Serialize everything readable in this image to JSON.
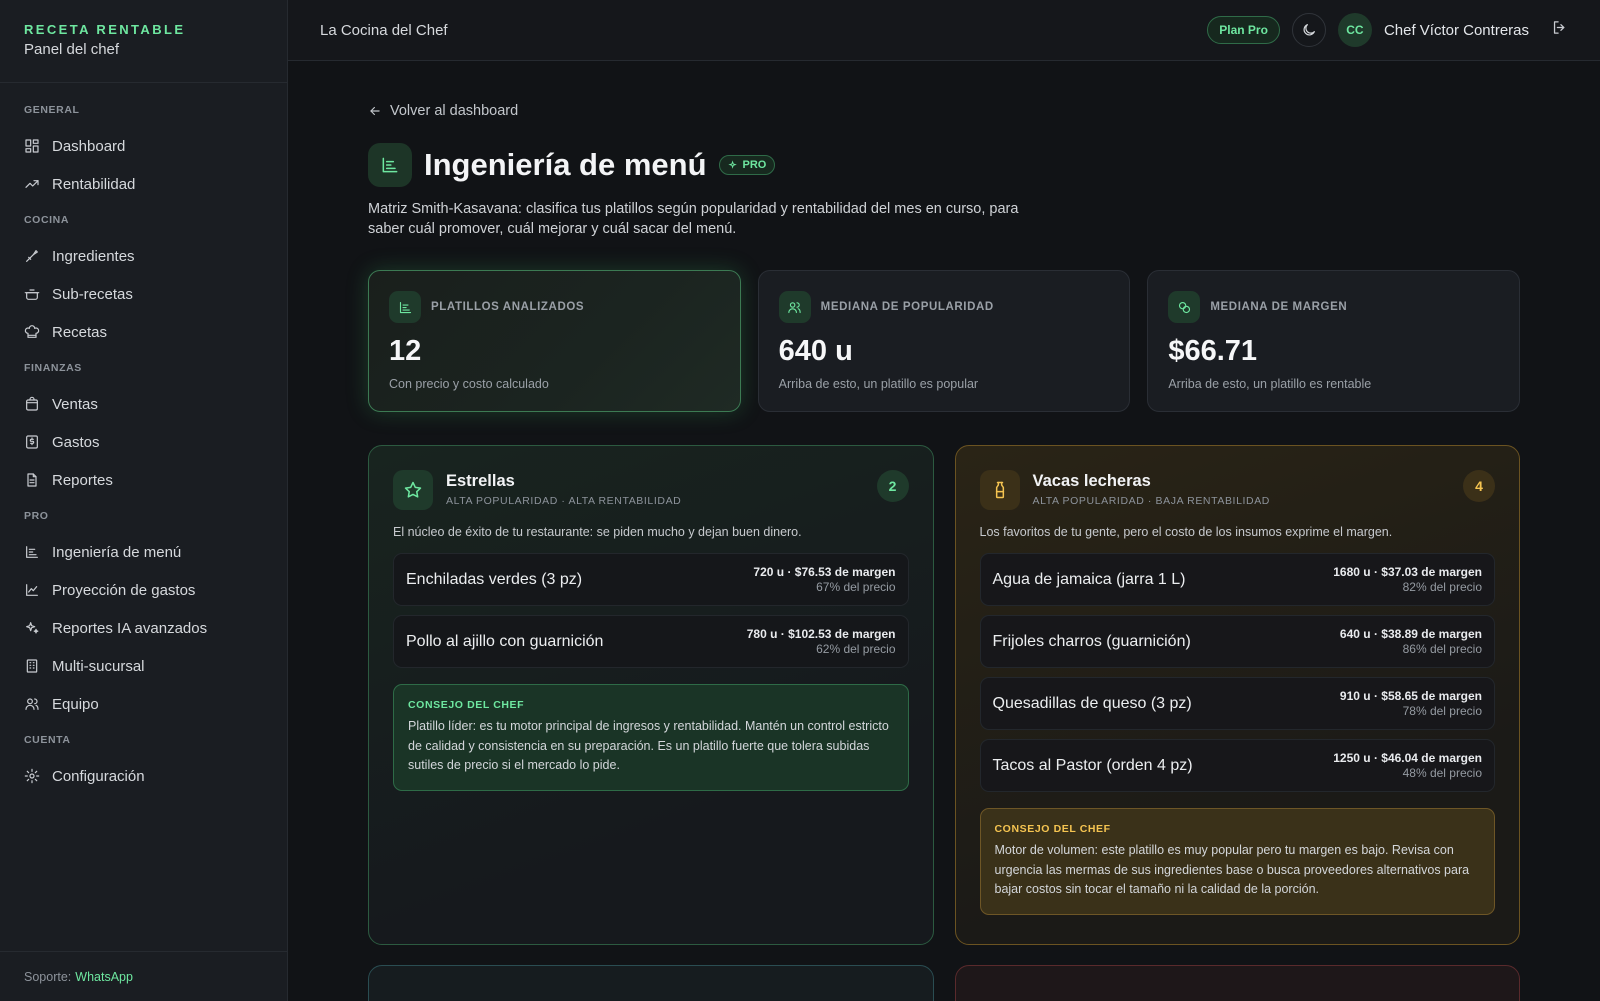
{
  "brand": {
    "name": "RECETA RENTABLE",
    "sub": "Panel del chef"
  },
  "sidebar": {
    "sections": [
      {
        "title": "GENERAL",
        "items": [
          {
            "label": "Dashboard",
            "icon": "grid-icon"
          },
          {
            "label": "Rentabilidad",
            "icon": "trending-up-icon"
          }
        ]
      },
      {
        "title": "COCINA",
        "items": [
          {
            "label": "Ingredientes",
            "icon": "knife-icon"
          },
          {
            "label": "Sub-recetas",
            "icon": "pot-icon"
          },
          {
            "label": "Recetas",
            "icon": "chef-hat-icon"
          }
        ]
      },
      {
        "title": "FINANZAS",
        "items": [
          {
            "label": "Ventas",
            "icon": "bag-icon"
          },
          {
            "label": "Gastos",
            "icon": "dollar-icon"
          },
          {
            "label": "Reportes",
            "icon": "file-icon"
          }
        ]
      },
      {
        "title": "PRO",
        "items": [
          {
            "label": "Ingeniería de menú",
            "icon": "chart-bars-icon"
          },
          {
            "label": "Proyección de gastos",
            "icon": "line-chart-icon"
          },
          {
            "label": "Reportes IA avanzados",
            "icon": "sparkles-icon"
          },
          {
            "label": "Multi-sucursal",
            "icon": "building-icon"
          },
          {
            "label": "Equipo",
            "icon": "users-icon"
          }
        ]
      },
      {
        "title": "CUENTA",
        "items": [
          {
            "label": "Configuración",
            "icon": "gear-icon"
          }
        ]
      }
    ],
    "support_label": "Soporte:",
    "support_link": "WhatsApp"
  },
  "topbar": {
    "title": "La Cocina del Chef",
    "plan": "Plan Pro",
    "avatar": "CC",
    "user": "Chef Víctor Contreras"
  },
  "page": {
    "back": "Volver al dashboard",
    "title": "Ingeniería de menú",
    "badge": "PRO",
    "description": "Matriz Smith-Kasavana: clasifica tus platillos según popularidad y rentabilidad del mes en curso, para saber cuál promover, cuál mejorar y cuál sacar del menú."
  },
  "stats": [
    {
      "label": "PLATILLOS ANALIZADOS",
      "value": "12",
      "note": "Con precio y costo calculado"
    },
    {
      "label": "MEDIANA DE POPULARIDAD",
      "value": "640 u",
      "note": "Arriba de esto, un platillo es popular"
    },
    {
      "label": "MEDIANA DE MARGEN",
      "value": "$66.71",
      "note": "Arriba de esto, un platillo es rentable"
    }
  ],
  "quadrants": [
    {
      "title": "Estrellas",
      "sub": "ALTA POPULARIDAD · ALTA RENTABILIDAD",
      "count": "2",
      "desc": "El núcleo de éxito de tu restaurante: se piden mucho y dejan buen dinero.",
      "dishes": [
        {
          "name": "Enchiladas verdes (3 pz)",
          "meta": "720 u · $76.53 de margen",
          "pct": "67% del precio"
        },
        {
          "name": "Pollo al ajillo con guarnición",
          "meta": "780 u · $102.53 de margen",
          "pct": "62% del precio"
        }
      ],
      "tip_title": "CONSEJO DEL CHEF",
      "tip_text": "Platillo líder: es tu motor principal de ingresos y rentabilidad. Mantén un control estricto de calidad y consistencia en su preparación. Es un platillo fuerte que tolera subidas sutiles de precio si el mercado lo pide."
    },
    {
      "title": "Vacas lecheras",
      "sub": "ALTA POPULARIDAD · BAJA RENTABILIDAD",
      "count": "4",
      "desc": "Los favoritos de tu gente, pero el costo de los insumos exprime el margen.",
      "dishes": [
        {
          "name": "Agua de jamaica (jarra 1 L)",
          "meta": "1680 u · $37.03 de margen",
          "pct": "82% del precio"
        },
        {
          "name": "Frijoles charros (guarnición)",
          "meta": "640 u · $38.89 de margen",
          "pct": "86% del precio"
        },
        {
          "name": "Quesadillas de queso (3 pz)",
          "meta": "910 u · $58.65 de margen",
          "pct": "78% del precio"
        },
        {
          "name": "Tacos al Pastor (orden 4 pz)",
          "meta": "1250 u · $46.04 de margen",
          "pct": "48% del precio"
        }
      ],
      "tip_title": "CONSEJO DEL CHEF",
      "tip_text": "Motor de volumen: este platillo es muy popular pero tu margen es bajo. Revisa con urgencia las mermas de sus ingredientes base o busca proveedores alternativos para bajar costos sin tocar el tamaño ni la calidad de la porción."
    }
  ],
  "colors": {
    "accent": "#6ee7a0",
    "amber": "#f5c451",
    "bg": "#111316"
  }
}
